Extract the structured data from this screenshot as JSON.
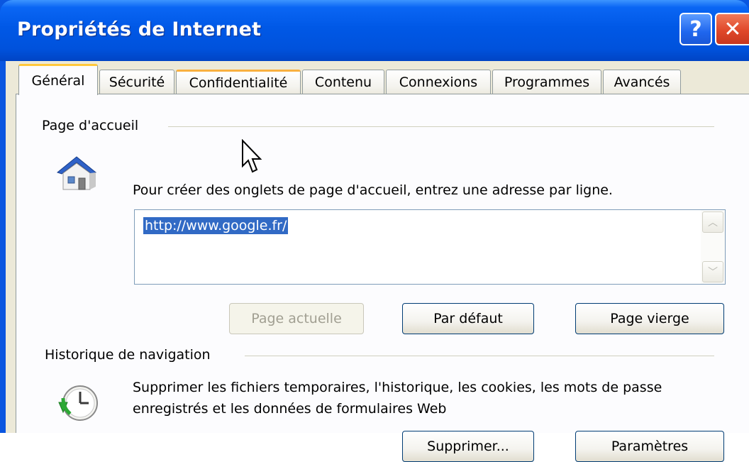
{
  "window": {
    "title": "Propriétés de Internet",
    "help_label": "?",
    "close_label": "✕"
  },
  "tabs": [
    {
      "label": "Général",
      "active": true
    },
    {
      "label": "Sécurité"
    },
    {
      "label": "Confidentialité"
    },
    {
      "label": "Contenu"
    },
    {
      "label": "Connexions"
    },
    {
      "label": "Programmes"
    },
    {
      "label": "Avancés"
    }
  ],
  "home_page": {
    "group_label": "Page d'accueil",
    "description": "Pour créer des onglets de page d'accueil, entrez une adresse par ligne.",
    "address_value": "http://www.google.fr/",
    "buttons": {
      "current": "Page actuelle",
      "default": "Par défaut",
      "blank": "Page vierge"
    }
  },
  "history": {
    "group_label": "Historique de navigation",
    "description_line1": "Supprimer les fichiers temporaires, l'historique, les cookies, les mots de passe",
    "description_line2": "enregistrés et les données de formulaires Web",
    "buttons": {
      "delete": "Supprimer...",
      "settings": "Paramètres"
    }
  },
  "colors": {
    "titlebar": "#0058e6",
    "selection": "#316ac5",
    "dialog": "#ece9d8"
  },
  "icons": [
    "help-icon",
    "close-icon",
    "home-icon",
    "history-clock-icon",
    "cursor-icon"
  ]
}
